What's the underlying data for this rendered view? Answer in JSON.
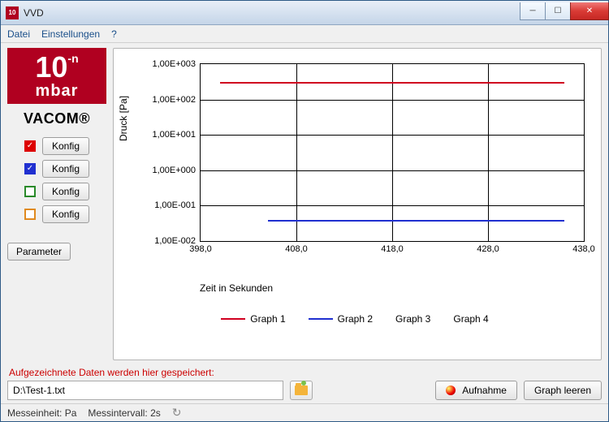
{
  "window": {
    "title": "VVD"
  },
  "menu": {
    "file": "Datei",
    "settings": "Einstellungen",
    "help": "?"
  },
  "logo": {
    "ten": "10",
    "exp": "-n",
    "unit": "mbar",
    "brand": "VACOM®"
  },
  "sidebar": {
    "channels": [
      {
        "color": "#d00020",
        "checked": true,
        "label": "Konfig"
      },
      {
        "color": "#2030d0",
        "checked": true,
        "label": "Konfig"
      },
      {
        "color": "#2a8a2a",
        "checked": false,
        "label": "Konfig"
      },
      {
        "color": "#e08a20",
        "checked": false,
        "label": "Konfig"
      }
    ],
    "parameter_label": "Parameter"
  },
  "chart_data": {
    "type": "line",
    "title": "",
    "xlabel": "Zeit in Sekunden",
    "ylabel": "Druck [Pa]",
    "xlim": [
      398.0,
      438.0
    ],
    "ylim_log10": [
      -2,
      3
    ],
    "xticks": [
      "398,0",
      "408,0",
      "418,0",
      "428,0",
      "438,0"
    ],
    "yticks": [
      "1,00E+003",
      "1,00E+002",
      "1,00E+001",
      "1,00E+000",
      "1,00E-001",
      "1,00E-002"
    ],
    "series": [
      {
        "name": "Graph 1",
        "color": "#d00020",
        "x": [
          400.0,
          436.0
        ],
        "values": [
          320.0,
          320.0
        ]
      },
      {
        "name": "Graph 2",
        "color": "#2030d0",
        "x": [
          405.0,
          436.0
        ],
        "values": [
          0.04,
          0.04
        ]
      },
      {
        "name": "Graph 3",
        "color": "#000000",
        "x": [],
        "values": []
      },
      {
        "name": "Graph 4",
        "color": "#000000",
        "x": [],
        "values": []
      }
    ]
  },
  "save": {
    "label": "Aufgezeichnete Daten werden hier gespeichert:",
    "path": "D:\\Test-1.txt",
    "record_label": "Aufnahme",
    "clear_label": "Graph leeren"
  },
  "status": {
    "unit": "Messeinheit: Pa",
    "interval": "Messintervall: 2s"
  }
}
